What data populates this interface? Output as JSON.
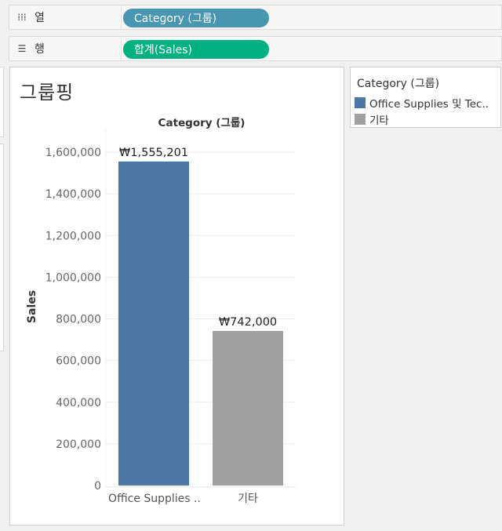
{
  "shelves": {
    "columns": {
      "label": "열",
      "icon": "columns-icon",
      "pill": "Category (그룹)",
      "pill_color": "#4996b2"
    },
    "rows": {
      "label": "행",
      "icon": "rows-icon",
      "pill": "합계(Sales)",
      "pill_color": "#00b180"
    }
  },
  "sheet": {
    "title": "그룹핑"
  },
  "legend": {
    "title": "Category (그룹)",
    "items": [
      {
        "label": "Office Supplies 및 Tec..",
        "color": "#4e79a7"
      },
      {
        "label": "기타",
        "color": "#a0a0a0"
      }
    ]
  },
  "chart_data": {
    "type": "bar",
    "title": "Category (그룹)",
    "ylabel": "Sales",
    "xlabel": "",
    "categories": [
      "Office Supplies ..",
      "기타"
    ],
    "values": [
      1555201,
      742000
    ],
    "data_labels": [
      "₩1,555,201",
      "₩742,000"
    ],
    "colors": [
      "#4e79a7",
      "#a0a0a0"
    ],
    "yticks": [
      0,
      200000,
      400000,
      600000,
      800000,
      1000000,
      1200000,
      1400000,
      1600000
    ],
    "ytick_labels": [
      "0",
      "200,000",
      "400,000",
      "600,000",
      "800,000",
      "1,000,000",
      "1,200,000",
      "1,400,000",
      "1,600,000"
    ],
    "ylim": [
      0,
      1650000
    ],
    "grid": true
  }
}
